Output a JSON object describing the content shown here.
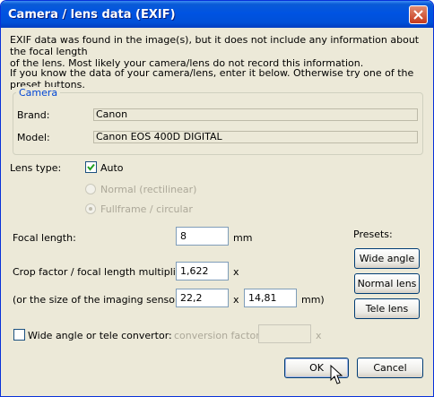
{
  "window": {
    "title": "Camera / lens data (EXIF)"
  },
  "info": {
    "line1": "EXIF data was found in the image(s), but it does not include any information about the focal length",
    "line2": "of the lens. Most likely your camera/lens do not record this information.",
    "line3": "If you know the data of your camera/lens, enter it below. Otherwise try one of the preset buttons."
  },
  "camera": {
    "group_label": "Camera",
    "brand_label": "Brand:",
    "brand_value": "Canon",
    "model_label": "Model:",
    "model_value": "Canon EOS 400D DIGITAL"
  },
  "lens": {
    "type_label": "Lens type:",
    "auto_label": "Auto",
    "auto_checked": true,
    "normal_label": "Normal (rectilinear)",
    "fullframe_label": "Fullframe / circular"
  },
  "focal": {
    "label": "Focal length:",
    "value": "8",
    "unit": "mm"
  },
  "crop": {
    "label": "Crop factor / focal length multiplier:",
    "value": "1,622",
    "unit": "x"
  },
  "sensor": {
    "label": "(or the size of the imaging sensor:",
    "width": "22,2",
    "sep": "x",
    "height": "14,81",
    "unit": "mm)"
  },
  "convertor": {
    "label": "Wide angle or tele convertor:",
    "checked": false,
    "factor_label": "conversion factor:",
    "factor_value": "",
    "unit": "x"
  },
  "presets": {
    "label": "Presets:",
    "wide": "Wide angle",
    "normal": "Normal lens",
    "tele": "Tele lens"
  },
  "buttons": {
    "ok": "OK",
    "cancel": "Cancel"
  },
  "colors": {
    "titlebar": "#0053e2",
    "dialog_bg": "#ece9d8",
    "group_caption": "#0046d5",
    "close_button": "#c5391c"
  }
}
